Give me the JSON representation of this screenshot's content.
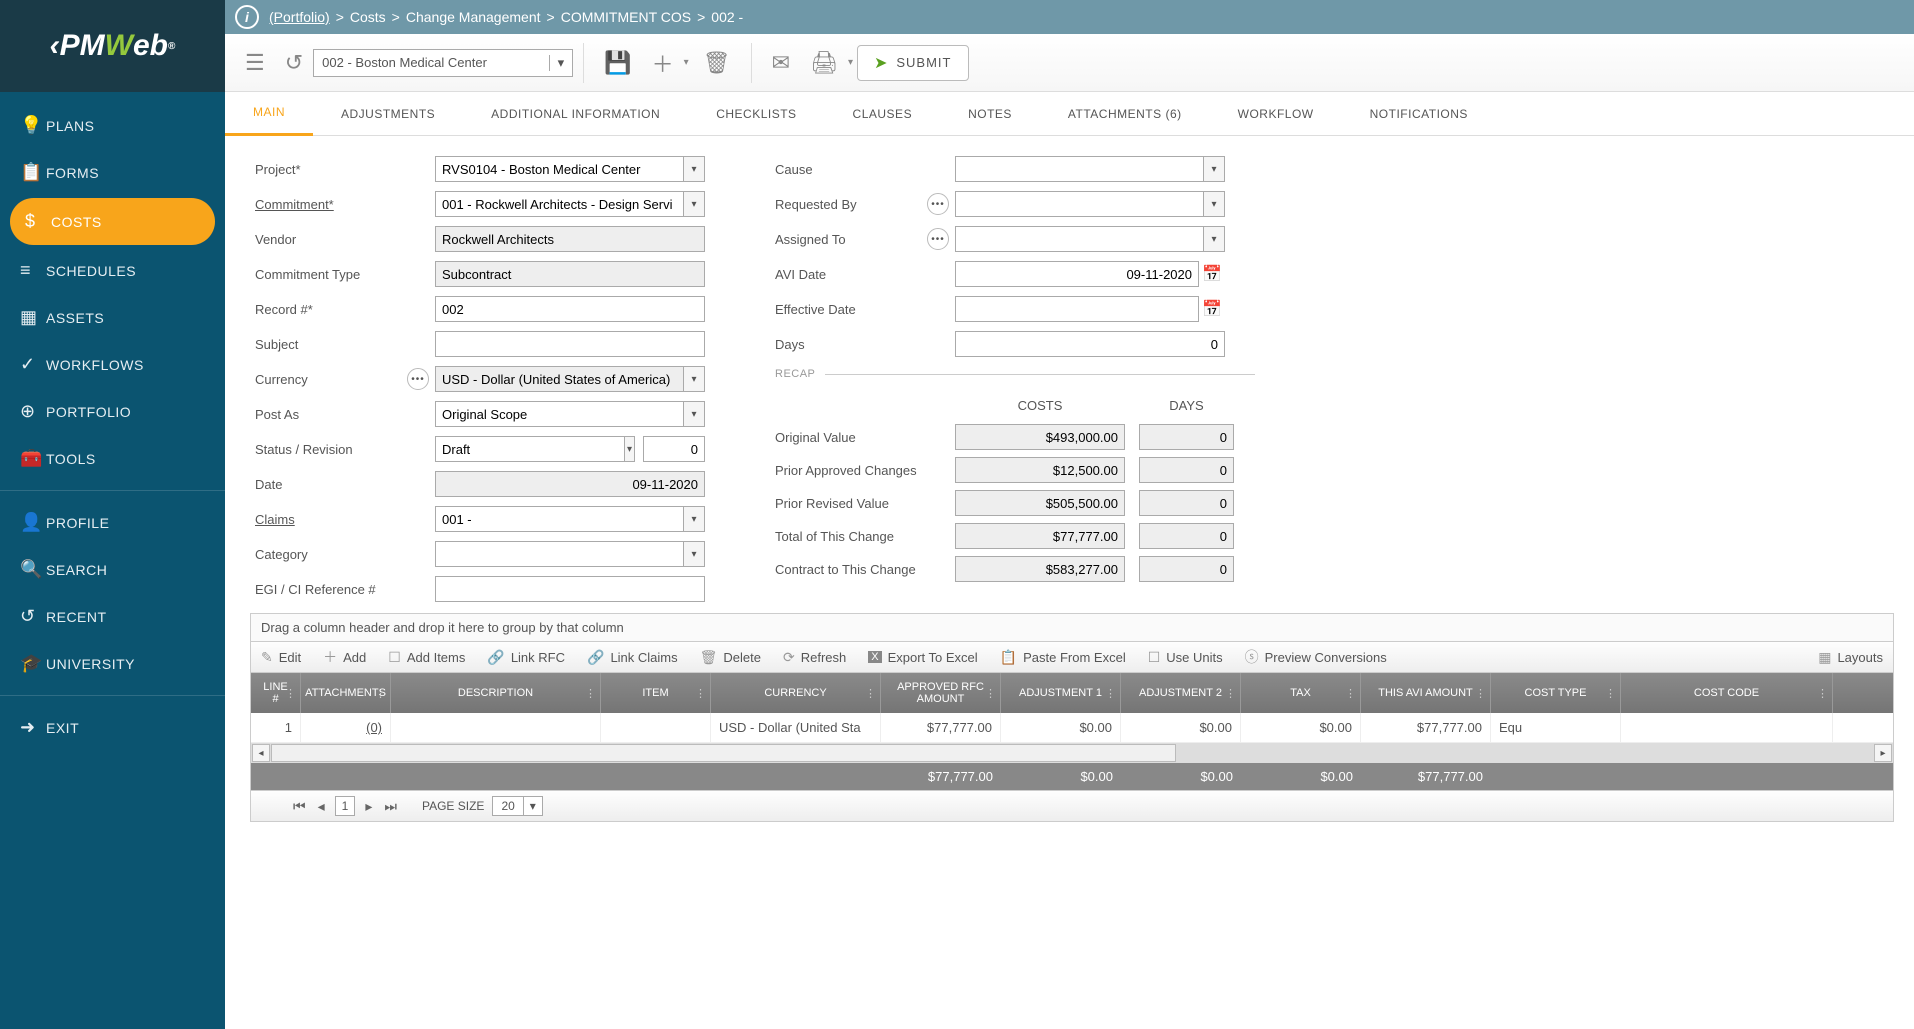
{
  "breadcrumb": [
    "(Portfolio)",
    "Costs",
    "Change Management",
    "COMMITMENT COS",
    "002 -"
  ],
  "record_selector": "002 - Boston Medical Center",
  "submit_label": "SUBMIT",
  "sidebar": [
    {
      "icon": "💡",
      "label": "PLANS"
    },
    {
      "icon": "📋",
      "label": "FORMS"
    },
    {
      "icon": "$",
      "label": "COSTS",
      "active": true
    },
    {
      "icon": "≡",
      "label": "SCHEDULES"
    },
    {
      "icon": "▦",
      "label": "ASSETS"
    },
    {
      "icon": "✓",
      "label": "WORKFLOWS"
    },
    {
      "icon": "⊕",
      "label": "PORTFOLIO"
    },
    {
      "icon": "🧰",
      "label": "TOOLS"
    },
    {
      "divider": true
    },
    {
      "icon": "👤",
      "label": "PROFILE"
    },
    {
      "icon": "🔍",
      "label": "SEARCH"
    },
    {
      "icon": "↺",
      "label": "RECENT"
    },
    {
      "icon": "🎓",
      "label": "UNIVERSITY"
    },
    {
      "divider": true
    },
    {
      "icon": "➜",
      "label": "EXIT"
    }
  ],
  "tabs": [
    "MAIN",
    "ADJUSTMENTS",
    "ADDITIONAL INFORMATION",
    "CHECKLISTS",
    "CLAUSES",
    "NOTES",
    "ATTACHMENTS (6)",
    "WORKFLOW",
    "NOTIFICATIONS"
  ],
  "active_tab": "MAIN",
  "form_left": {
    "project": {
      "label": "Project*",
      "value": "RVS0104 - Boston Medical Center"
    },
    "commitment": {
      "label": "Commitment*",
      "value": "001 - Rockwell Architects - Design Servi"
    },
    "vendor": {
      "label": "Vendor",
      "value": "Rockwell Architects"
    },
    "commitment_type": {
      "label": "Commitment Type",
      "value": "Subcontract"
    },
    "record_no": {
      "label": "Record #*",
      "value": "002"
    },
    "subject": {
      "label": "Subject",
      "value": ""
    },
    "currency": {
      "label": "Currency",
      "value": "USD - Dollar (United States of America)"
    },
    "post_as": {
      "label": "Post As",
      "value": "Original Scope"
    },
    "status": {
      "label": "Status / Revision",
      "value": "Draft",
      "rev": "0"
    },
    "date": {
      "label": "Date",
      "value": "09-11-2020"
    },
    "claims": {
      "label": "Claims",
      "value": "001 -"
    },
    "category": {
      "label": "Category",
      "value": ""
    },
    "egi": {
      "label": "EGI / CI Reference #",
      "value": ""
    }
  },
  "form_right": {
    "cause": {
      "label": "Cause",
      "value": ""
    },
    "requested_by": {
      "label": "Requested By",
      "value": ""
    },
    "assigned_to": {
      "label": "Assigned To",
      "value": ""
    },
    "avi_date": {
      "label": "AVI Date",
      "value": "09-11-2020"
    },
    "effective_date": {
      "label": "Effective Date",
      "value": ""
    },
    "days": {
      "label": "Days",
      "value": "0"
    }
  },
  "recap": {
    "title": "RECAP",
    "col_costs": "COSTS",
    "col_days": "DAYS",
    "rows": [
      {
        "label": "Original Value",
        "cost": "$493,000.00",
        "days": "0"
      },
      {
        "label": "Prior Approved Changes",
        "cost": "$12,500.00",
        "days": "0"
      },
      {
        "label": "Prior Revised Value",
        "cost": "$505,500.00",
        "days": "0"
      },
      {
        "label": "Total of This Change",
        "cost": "$77,777.00",
        "days": "0"
      },
      {
        "label": "Contract to This Change",
        "cost": "$583,277.00",
        "days": "0"
      }
    ]
  },
  "grid": {
    "group_hint": "Drag a column header and drop it here to group by that column",
    "tools": {
      "edit": "Edit",
      "add": "Add",
      "add_items": "Add Items",
      "link_rfc": "Link RFC",
      "link_claims": "Link Claims",
      "delete": "Delete",
      "refresh": "Refresh",
      "export": "Export To Excel",
      "paste": "Paste From Excel",
      "use_units": "Use Units",
      "preview": "Preview Conversions",
      "layouts": "Layouts"
    },
    "headers": [
      "LINE #",
      "ATTACHMENTS",
      "DESCRIPTION",
      "ITEM",
      "CURRENCY",
      "APPROVED RFC AMOUNT",
      "ADJUSTMENT 1",
      "ADJUSTMENT 2",
      "TAX",
      "THIS AVI AMOUNT",
      "COST TYPE",
      "COST CODE"
    ],
    "rows": [
      {
        "line": "1",
        "att": "(0)",
        "desc": "",
        "item": "",
        "curr": "USD - Dollar (United Sta",
        "approved": "$77,777.00",
        "adj1": "$0.00",
        "adj2": "$0.00",
        "tax": "$0.00",
        "avi": "$77,777.00",
        "cost_type": "Equ",
        "cost_code": ""
      }
    ],
    "totals": {
      "approved": "$77,777.00",
      "adj1": "$0.00",
      "adj2": "$0.00",
      "tax": "$0.00",
      "avi": "$77,777.00"
    },
    "pager": {
      "page": "1",
      "page_size_label": "PAGE SIZE",
      "page_size": "20"
    }
  }
}
